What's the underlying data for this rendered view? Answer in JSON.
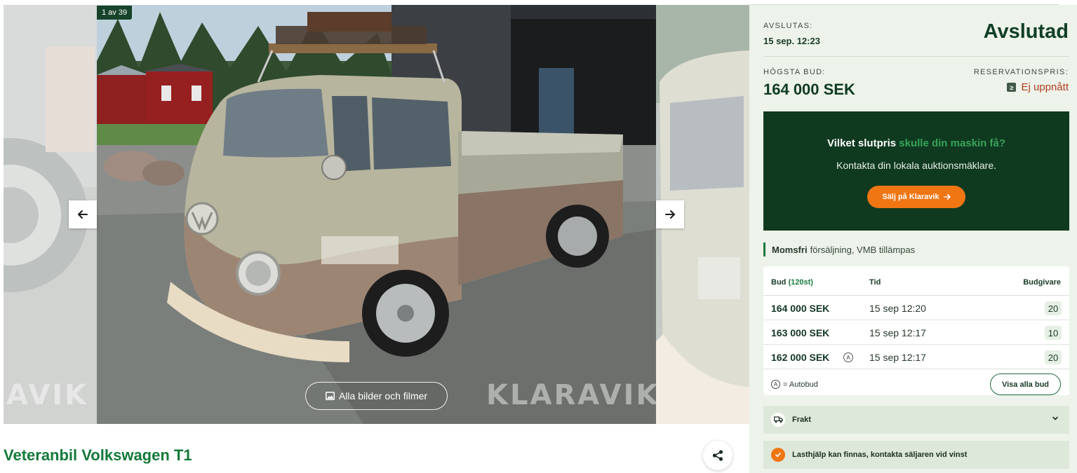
{
  "gallery": {
    "counter": "1 av 39",
    "all_images_label": "Alla bilder och filmer",
    "watermark": "KLARAVIK",
    "watermark_left": "AVIK"
  },
  "listing": {
    "title": "Veteranbil Volkswagen T1"
  },
  "auction": {
    "ends_label": "AVSLUTAS:",
    "ends_date": "15 sep. 12:23",
    "status": "Avslutad",
    "highest_bid_label": "HÖGSTA BUD:",
    "highest_bid": "164 000 SEK",
    "reserve_label": "RESERVATIONSPRIS:",
    "reserve_status": "Ej uppnått"
  },
  "promo": {
    "title_part1": "Vilket slutpris",
    "title_part2": "skulle din maskin få?",
    "subtitle": "Kontakta din lokala auktionsmäklare.",
    "button_label": "Sälj på Klaravik"
  },
  "vat": {
    "bold": "Momsfri",
    "rest": "försäljning, VMB tillämpas"
  },
  "bids": {
    "header_bid": "Bud",
    "header_count": "(120st)",
    "header_time": "Tid",
    "header_bidder": "Budgivare",
    "rows": [
      {
        "amount": "164 000 SEK",
        "time": "15 sep 12:20",
        "bidder": "20",
        "auto": false
      },
      {
        "amount": "163 000 SEK",
        "time": "15 sep 12:17",
        "bidder": "10",
        "auto": false
      },
      {
        "amount": "162 000 SEK",
        "time": "15 sep 12:17",
        "bidder": "20",
        "auto": true
      }
    ],
    "auto_symbol": "A",
    "auto_legend": "= Autobud",
    "show_all_label": "Visa alla bud"
  },
  "accordions": {
    "freight": "Frakt",
    "lift": "Lasthjälp kan finnas, kontakta säljaren vid vinst"
  },
  "colors": {
    "brand_green": "#137a3a",
    "dark_green": "#0f3a20",
    "orange": "#f07614",
    "reserve_red": "#b13e1c",
    "panel_bg": "#edf3ea"
  }
}
